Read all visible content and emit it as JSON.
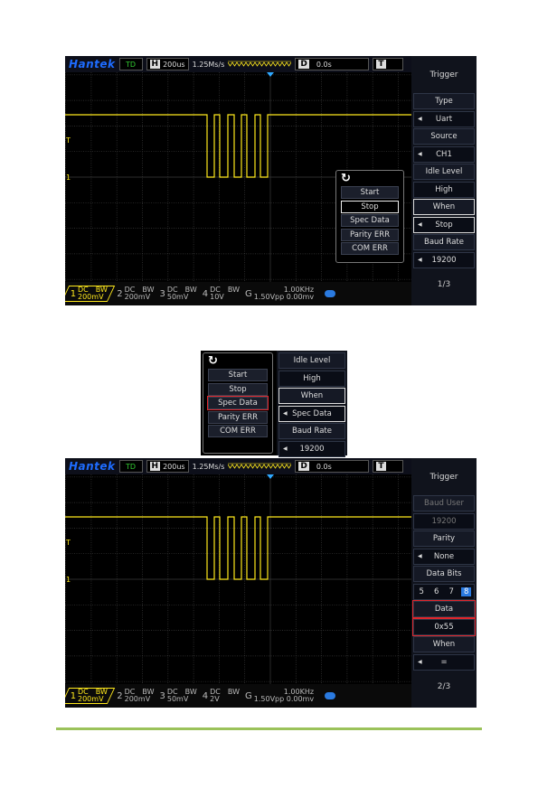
{
  "colors": {
    "signal": "#ffe91c",
    "brand": "#1e6cff",
    "highlight": "#e0262c",
    "accent": "#9bc25a"
  },
  "scopes": [
    {
      "header": {
        "logo": "Hantek",
        "status": "TD",
        "h_label": "H",
        "timebase": "200us",
        "sample_rate": "1.25Ms/s",
        "d_label": "D",
        "delay": "0.0s",
        "t_label": "T"
      },
      "panel": {
        "title": "Trigger",
        "page": "1/3",
        "cells": [
          {
            "text": "Type",
            "kind": "hdrc"
          },
          {
            "text": "Uart",
            "kind": "val",
            "arrow": true
          },
          {
            "text": "Source",
            "kind": "hdrc"
          },
          {
            "text": "CH1",
            "kind": "val",
            "arrow": true
          },
          {
            "text": "Idle Level",
            "kind": "hdrc"
          },
          {
            "text": "High",
            "kind": "val"
          },
          {
            "text": "When",
            "kind": "hdrc sel"
          },
          {
            "text": "Stop",
            "kind": "val sel",
            "arrow": true
          },
          {
            "text": "Baud Rate",
            "kind": "hdrc"
          },
          {
            "text": "19200",
            "kind": "val",
            "arrow": true
          }
        ]
      },
      "popup": {
        "icon": "rotate-icon",
        "items": [
          "Start",
          "Stop",
          "Spec Data",
          "Parity ERR",
          "COM ERR"
        ],
        "selected": "Stop"
      },
      "channels": [
        {
          "n": "1",
          "coupling": "DC",
          "bw": "BW",
          "scale": "200mV"
        },
        {
          "n": "2",
          "coupling": "DC",
          "bw": "BW",
          "scale": "200mV"
        },
        {
          "n": "3",
          "coupling": "DC",
          "bw": "BW",
          "scale": "50mV"
        },
        {
          "n": "4",
          "coupling": "DC",
          "bw": "BW",
          "scale": "10V"
        }
      ],
      "gen": {
        "n": "G",
        "freq": "1.00KHz",
        "amp": "1.50Vpp 0.00mv"
      }
    },
    {
      "header": {
        "logo": "Hantek",
        "status": "TD",
        "h_label": "H",
        "timebase": "200us",
        "sample_rate": "1.25Ms/s",
        "d_label": "D",
        "delay": "0.0s",
        "t_label": "T"
      },
      "panel": {
        "title": "Trigger",
        "page": "2/3",
        "cells": [
          {
            "text": "Baud User",
            "kind": "hdrc dim"
          },
          {
            "text": "19200",
            "kind": "val dim"
          },
          {
            "text": "Parity",
            "kind": "hdrc"
          },
          {
            "text": "None",
            "kind": "val",
            "arrow": true
          },
          {
            "text": "Data Bits",
            "kind": "hdrc"
          },
          {
            "bits": [
              "5",
              "6",
              "7",
              "8"
            ],
            "selected": "8",
            "kind": "val"
          },
          {
            "text": "Data",
            "kind": "hdrc red"
          },
          {
            "text": "0x55",
            "kind": "val red"
          },
          {
            "text": "When",
            "kind": "hdrc"
          },
          {
            "text": "=",
            "kind": "val",
            "arrow": true
          }
        ]
      },
      "channels": [
        {
          "n": "1",
          "coupling": "DC",
          "bw": "BW",
          "scale": "200mV"
        },
        {
          "n": "2",
          "coupling": "DC",
          "bw": "BW",
          "scale": "200mV"
        },
        {
          "n": "3",
          "coupling": "DC",
          "bw": "BW",
          "scale": "50mV"
        },
        {
          "n": "4",
          "coupling": "DC",
          "bw": "BW",
          "scale": "2V"
        }
      ],
      "gen": {
        "n": "G",
        "freq": "1.00KHz",
        "amp": "1.50Vpp 0.00mv"
      }
    }
  ],
  "crop": {
    "menu": [
      "Start",
      "Stop",
      "Spec Data",
      "Parity ERR",
      "COM ERR"
    ],
    "highlighted": "Spec Data",
    "cells": [
      {
        "text": "Idle Level",
        "kind": "hdrc"
      },
      {
        "text": "High",
        "kind": "val"
      },
      {
        "text": "When",
        "kind": "hdrc sel"
      },
      {
        "text": "Spec Data",
        "kind": "val sel",
        "arrow": true
      },
      {
        "text": "Baud Rate",
        "kind": "hdrc"
      },
      {
        "text": "19200",
        "kind": "val",
        "arrow": true
      }
    ]
  }
}
